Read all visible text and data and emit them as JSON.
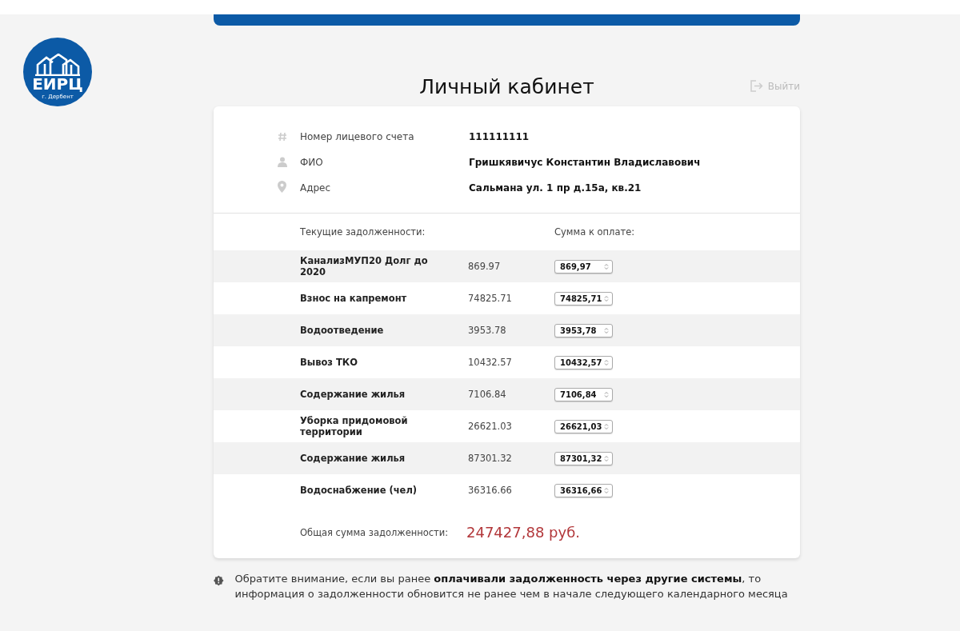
{
  "logo": {
    "title": "ЕИРЦ",
    "subtitle": "г. Дербент"
  },
  "page_title": "Личный кабинет",
  "logout": {
    "label": "Выйти"
  },
  "account": [
    {
      "kind": "number",
      "label": "Номер лицевого счета",
      "value": "111111111"
    },
    {
      "kind": "person",
      "label": "ФИО",
      "value": "Гришкявичус Константин Владиславович"
    },
    {
      "kind": "address",
      "label": "Адрес",
      "value": "Сальмана ул. 1 пр д.15а, кв.21"
    }
  ],
  "debts": {
    "columns": [
      "Текущие задолженности:",
      "Сумма к оплате:"
    ],
    "rows": [
      {
        "name": "КанализМУП20 Долг до 2020",
        "amount": "869.97",
        "pay": "869,97"
      },
      {
        "name": "Взнос на капремонт",
        "amount": "74825.71",
        "pay": "74825,71"
      },
      {
        "name": "Водоотведение",
        "amount": "3953.78",
        "pay": "3953,78"
      },
      {
        "name": "Вывоз ТКО",
        "amount": "10432.57",
        "pay": "10432,57"
      },
      {
        "name": "Содержание жилья",
        "amount": "7106.84",
        "pay": "7106,84"
      },
      {
        "name": "Уборка придомовой территории",
        "amount": "26621.03",
        "pay": "26621,03"
      },
      {
        "name": "Содержание жилья",
        "amount": "87301.32",
        "pay": "87301,32"
      },
      {
        "name": "Водоснабжение (чел)",
        "amount": "36316.66",
        "pay": "36316,66"
      }
    ],
    "total_label": "Общая сумма задолженности:",
    "total": "247427,88 руб."
  },
  "notice": "Обратите внимание, если вы ранее **оплачивали задолженность через другие системы**, то информация о задолженности обновится не ранее чем в начале следующего календарного месяца"
}
